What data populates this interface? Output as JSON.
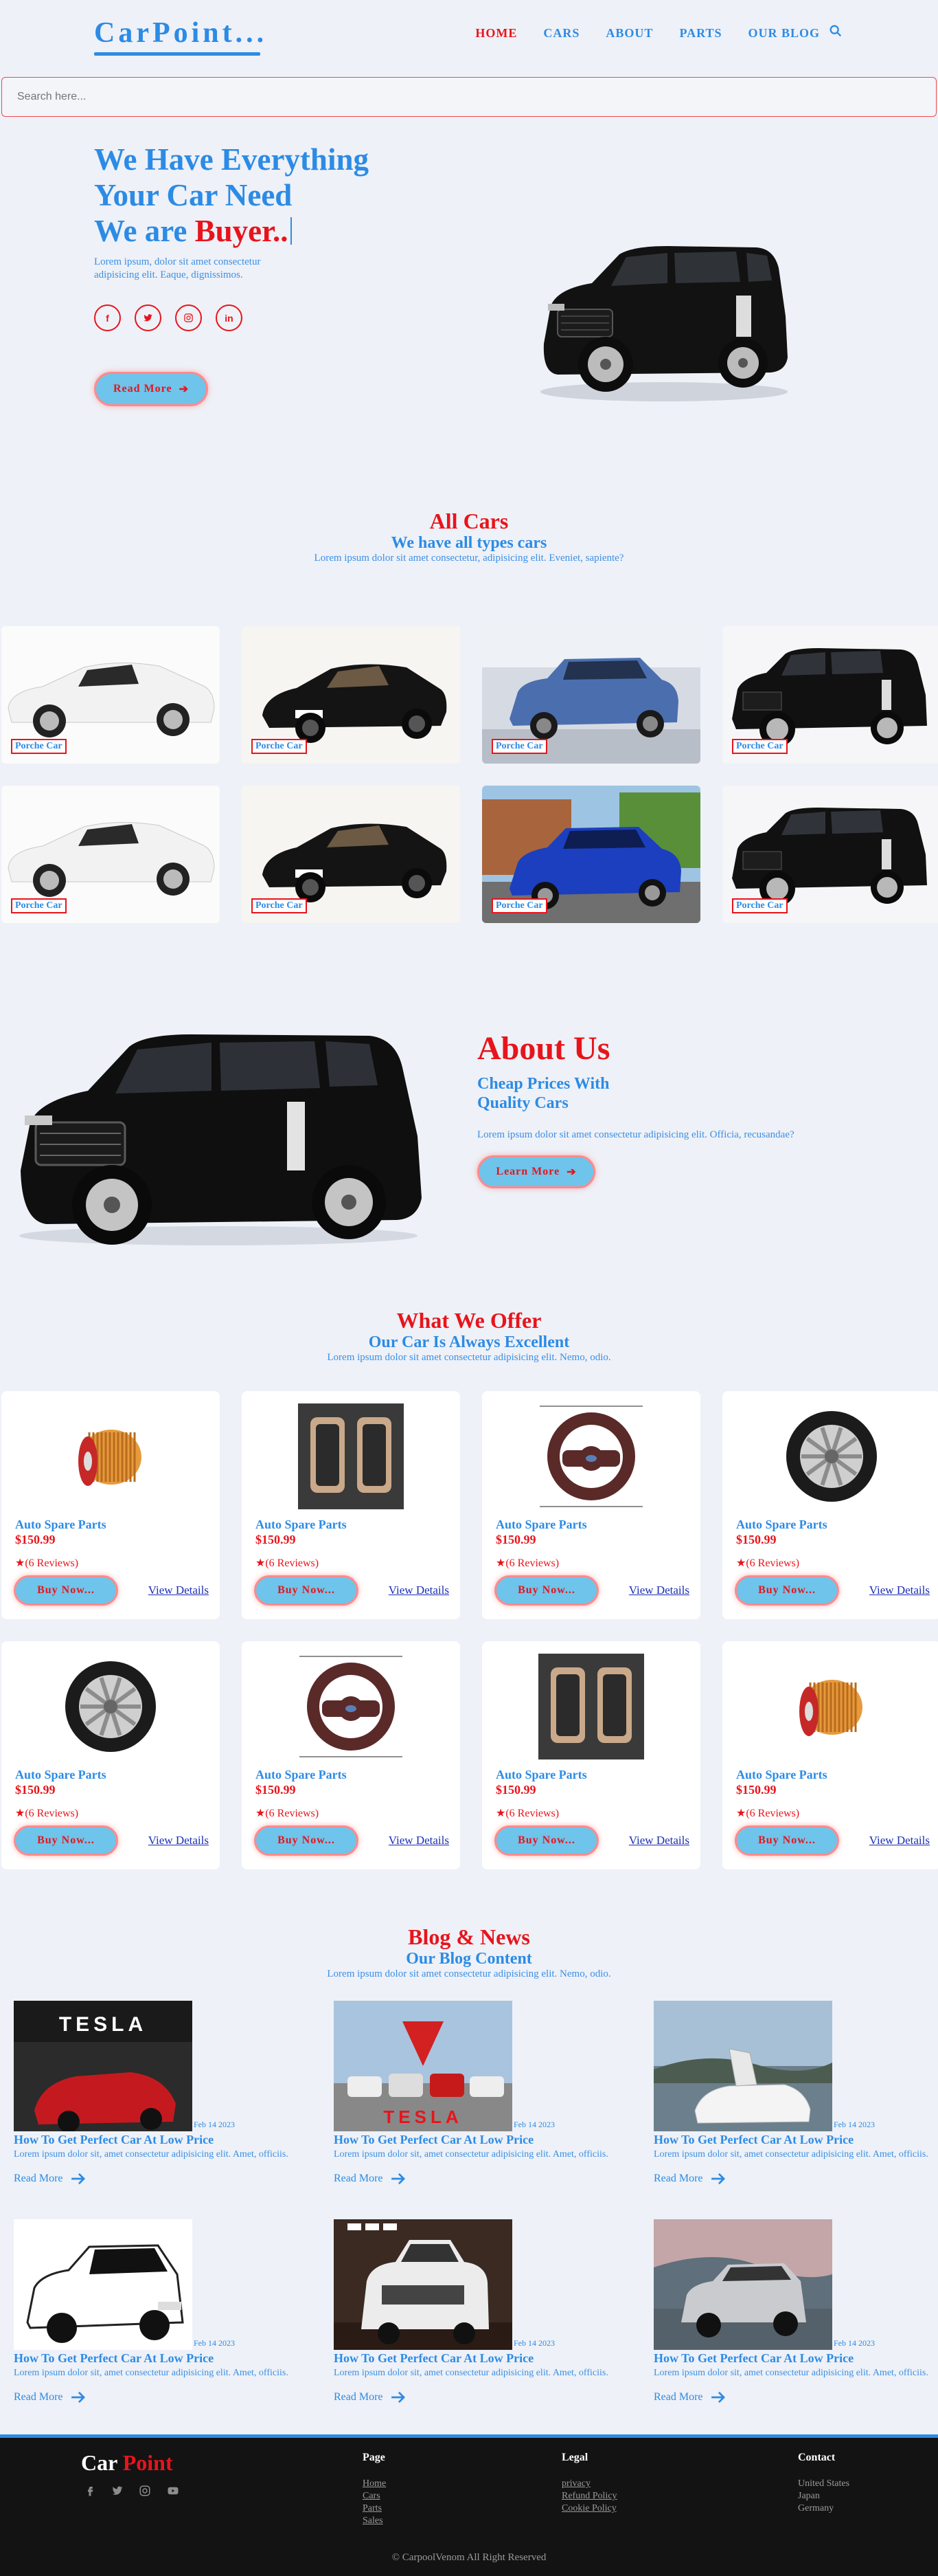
{
  "header": {
    "logo": "CarPoint...",
    "nav": [
      "HOME",
      "CARS",
      "ABOUT",
      "PARTS",
      "OUR BLOG"
    ],
    "search_placeholder": "Search here..."
  },
  "hero": {
    "line1": "We Have Everything",
    "line2": "Your Car Need",
    "line3_prefix": "We are ",
    "line3_highlight": "Buyer..",
    "text": "Lorem ipsum, dolor sit amet consectetur adipisicing elit. Eaque, dignissimos.",
    "socials": [
      "f",
      "t",
      "ig",
      "in"
    ],
    "button": "Read More"
  },
  "cars": {
    "title": "All Cars",
    "subtitle": "We have all types cars",
    "text": "Lorem ipsum dolor sit amet consectetur, adipisicing elit. Eveniet, sapiente?",
    "items": [
      {
        "label": "Porche Car",
        "color": "white"
      },
      {
        "label": "Porche Car",
        "color": "black-sedan"
      },
      {
        "label": "Porche Car",
        "color": "blue-suv"
      },
      {
        "label": "Porche Car",
        "color": "black-suv"
      },
      {
        "label": "Porche Car",
        "color": "white"
      },
      {
        "label": "Porche Car",
        "color": "black-sedan"
      },
      {
        "label": "Porche Car",
        "color": "blue-suv-outdoor"
      },
      {
        "label": "Porche Car",
        "color": "black-suv"
      }
    ]
  },
  "about": {
    "title": "About Us",
    "subtitle": "Cheap Prices With Quality Cars",
    "text": "Lorem ipsum dolor sit amet consectetur adipisicing elit. Officia, recusandae?",
    "button": "Learn More"
  },
  "offer": {
    "title": "What We Offer",
    "subtitle": "Our Car Is Always Excellent",
    "text": "Lorem ipsum dolor sit amet consectetur adipisicing elit. Nemo, odio.",
    "items": [
      {
        "name": "Auto Spare Parts",
        "price": "$150.99",
        "reviews": "(6 Reviews)",
        "button": "Buy Now...",
        "link": "View Details",
        "icon": "oil-filter"
      },
      {
        "name": "Auto Spare Parts",
        "price": "$150.99",
        "reviews": "(6 Reviews)",
        "button": "Buy Now...",
        "link": "View Details",
        "icon": "car-seat"
      },
      {
        "name": "Auto Spare Parts",
        "price": "$150.99",
        "reviews": "(6 Reviews)",
        "button": "Buy Now...",
        "link": "View Details",
        "icon": "steering-wheel"
      },
      {
        "name": "Auto Spare Parts",
        "price": "$150.99",
        "reviews": "(6 Reviews)",
        "button": "Buy Now...",
        "link": "View Details",
        "icon": "alloy-wheel"
      },
      {
        "name": "Auto Spare Parts",
        "price": "$150.99",
        "reviews": "(6 Reviews)",
        "button": "Buy Now...",
        "link": "View Details",
        "icon": "alloy-wheel"
      },
      {
        "name": "Auto Spare Parts",
        "price": "$150.99",
        "reviews": "(6 Reviews)",
        "button": "Buy Now...",
        "link": "View Details",
        "icon": "steering-wheel"
      },
      {
        "name": "Auto Spare Parts",
        "price": "$150.99",
        "reviews": "(6 Reviews)",
        "button": "Buy Now...",
        "link": "View Details",
        "icon": "car-seat"
      },
      {
        "name": "Auto Spare Parts",
        "price": "$150.99",
        "reviews": "(6 Reviews)",
        "button": "Buy Now...",
        "link": "View Details",
        "icon": "oil-filter"
      }
    ]
  },
  "blog": {
    "title": "Blog & News",
    "subtitle": "Our Blog Content",
    "text": "Lorem ipsum dolor sit amet consectetur adipisicing elit. Nemo, odio.",
    "posts": [
      {
        "date": "Feb 14 2023",
        "title": "How To Get Perfect Car At Low Price",
        "text": "Lorem ipsum dolor sit, amet consectetur adipisicing elit. Amet, officiis.",
        "more": "Read More",
        "image": "tesla-store",
        "sign": "TESLA"
      },
      {
        "date": "Feb 14 2023",
        "title": "How To Get Perfect Car At Low Price",
        "text": "Lorem ipsum dolor sit, amet consectetur adipisicing elit. Amet, officiis.",
        "more": "Read More",
        "image": "tesla-lineup",
        "sign": "TESLA"
      },
      {
        "date": "Feb 14 2023",
        "title": "How To Get Perfect Car At Low Price",
        "text": "Lorem ipsum dolor sit, amet consectetur adipisicing elit. Amet, officiis.",
        "more": "Read More",
        "image": "tesla-coast"
      },
      {
        "date": "Feb 14 2023",
        "title": "How To Get Perfect Car At Low Price",
        "text": "Lorem ipsum dolor sit, amet consectetur adipisicing elit. Amet, officiis.",
        "more": "Read More",
        "image": "white-suv"
      },
      {
        "date": "Feb 14 2023",
        "title": "How To Get Perfect Car At Low Price",
        "text": "Lorem ipsum dolor sit, amet consectetur adipisicing elit. Amet, officiis.",
        "more": "Read More",
        "image": "range-rover-garage"
      },
      {
        "date": "Feb 14 2023",
        "title": "How To Get Perfect Car At Low Price",
        "text": "Lorem ipsum dolor sit, amet consectetur adipisicing elit. Amet, officiis.",
        "more": "Read More",
        "image": "range-rover-coast"
      }
    ]
  },
  "footer": {
    "logo_a": "Car",
    "logo_b": "Point",
    "social_icons": [
      "facebook-icon",
      "twitter-icon",
      "instagram-icon",
      "youtube-icon"
    ],
    "page_title": "Page",
    "page_links": [
      "Home",
      "Cars",
      "Parts",
      "Sales"
    ],
    "legal_title": "Legal",
    "legal_links": [
      "privacy",
      "Refund Policy",
      "Cookie Policy"
    ],
    "contact_title": "Contact",
    "contact_items": [
      "United States",
      "Japan",
      "Germany"
    ],
    "copyright": "© CarpoolVenom All Right Reserved"
  },
  "colors": {
    "accent": "#2c8be5",
    "highlight": "#e8141b",
    "button": "#6ec4ea",
    "footer": "#131313"
  }
}
